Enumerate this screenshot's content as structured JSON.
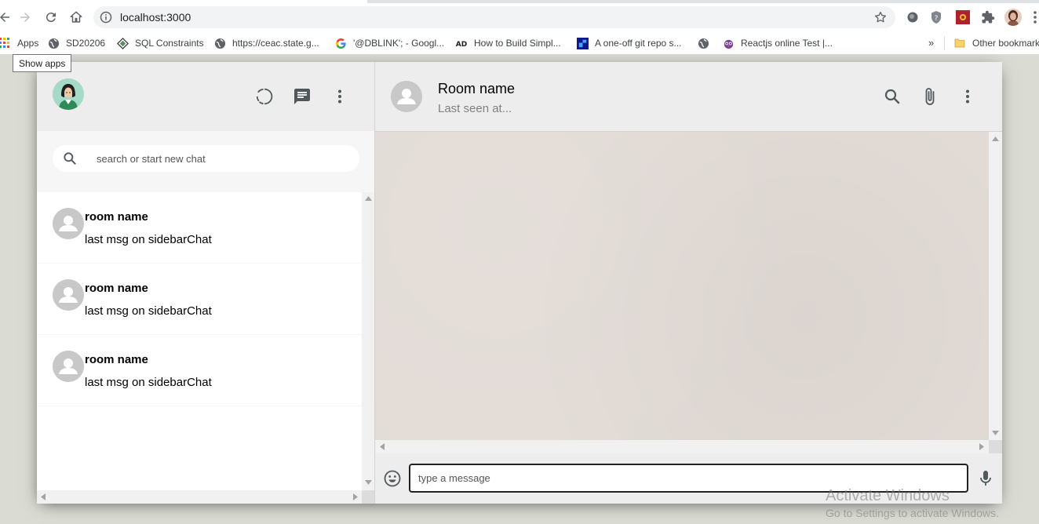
{
  "browser": {
    "url": "localhost:3000",
    "bookmarks": [
      {
        "label": "Apps",
        "icon": "apps-grid-icon"
      },
      {
        "label": "SD20206",
        "icon": "globe-icon"
      },
      {
        "label": "SQL Constraints",
        "icon": "diamond-logo-icon"
      },
      {
        "label": "https://ceac.state.g...",
        "icon": "globe-icon"
      },
      {
        "label": "'@DBLINK'; - Googl...",
        "icon": "google-icon"
      },
      {
        "label": "How to Build Simpl...",
        "icon": "ad-icon"
      },
      {
        "label": "A one-off git repo s...",
        "icon": "blue-square-icon"
      },
      {
        "label": "",
        "icon": "globe-icon"
      },
      {
        "label": "Reactjs online Test |...",
        "icon": "owl-icon"
      }
    ],
    "more_bookmarks": "»",
    "other_bookmarks": "Other bookmarks",
    "tooltip": "Show apps"
  },
  "sidebar": {
    "search_placeholder": "search or start new chat",
    "chats": [
      {
        "name": "room name",
        "last_msg": "last msg on sidebarChat"
      },
      {
        "name": "room name",
        "last_msg": "last msg on sidebarChat"
      },
      {
        "name": "room name",
        "last_msg": "last msg on sidebarChat"
      }
    ]
  },
  "chat": {
    "room_name": "Room name",
    "last_seen": "Last seen at...",
    "input_placeholder": "type a message"
  },
  "watermark": {
    "title": "Activate Windows",
    "subtitle": "Go to Settings to activate Windows."
  },
  "colors": {
    "header_bg": "#ededed",
    "chat_bg": "#e5ddd5",
    "icon_gray": "#51585c"
  }
}
